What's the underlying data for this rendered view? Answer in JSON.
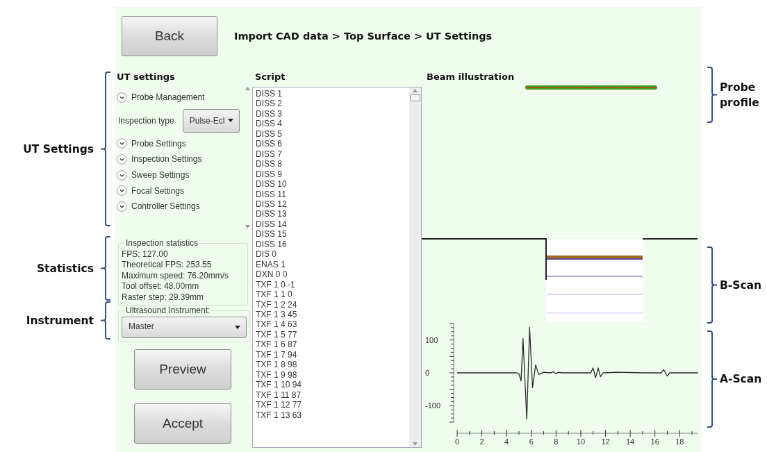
{
  "annotations_left": [
    {
      "label": "UT Settings"
    },
    {
      "label": "Statistics"
    },
    {
      "label": "Instrument"
    }
  ],
  "annotations_right": [
    {
      "label": "Probe profile"
    },
    {
      "label": "B-Scan"
    },
    {
      "label": "A-Scan"
    }
  ],
  "back_button": "Back",
  "breadcrumb": "Import CAD data > Top Surface > UT Settings",
  "ut_settings": {
    "title": "UT settings",
    "items": [
      {
        "kind": "expander",
        "label": "Probe Management"
      },
      {
        "kind": "combo",
        "label": "Inspection type",
        "value": "Pulse-Ecl"
      },
      {
        "kind": "expander",
        "label": "Probe Settings"
      },
      {
        "kind": "expander",
        "label": "Inspection Settings"
      },
      {
        "kind": "expander",
        "label": "Sweep Settings"
      },
      {
        "kind": "expander",
        "label": "Focal Settings"
      },
      {
        "kind": "expander",
        "label": "Controller Settings"
      }
    ]
  },
  "statistics": {
    "title": "Inspection statistics",
    "lines": [
      "FPS: 127.00",
      "Theoretical FPS: 253.55",
      "Maximum speed: 76.20mm/s",
      "Tool offset: 48.00mm",
      "Raster step: 29.39mm"
    ]
  },
  "instrument": {
    "title": "Ultrasound Instrument:",
    "value": "Master"
  },
  "buttons": [
    "Preview",
    "Accept"
  ],
  "script": {
    "title": "Script",
    "lines": [
      "DISS 1",
      "DISS 2",
      "DISS 3",
      "DISS 4",
      "DISS 5",
      "DISS 6",
      "DISS 7",
      "DISS 8",
      "DISS 9",
      "DISS 10",
      "DISS 11",
      "DISS 12",
      "DISS 13",
      "DISS 14",
      "DISS 15",
      "DISS 16",
      "DIS 0",
      "ENAS 1",
      "DXN 0 0",
      "TXF 1 0 -1",
      "TXF 1 1 0",
      "TXF 1 2 24",
      "TXF 1 3 45",
      "TXF 1 4 63",
      "TXF 1 5 77",
      "TXF 1 6 87",
      "TXF 1 7 94",
      "TXF 1 8 98",
      "TXF 1 9 98",
      "TXF 1 10 94",
      "TXF 1 11 87",
      "TXF 1 12 77",
      "TXF 1 13 63"
    ]
  },
  "beam": {
    "title": "Beam illustration"
  },
  "a_scan": {
    "chart_data": {
      "type": "line",
      "x": [
        0,
        4.8,
        5.0,
        5.17,
        5.33,
        5.63,
        5.86,
        6.1,
        6.35,
        6.6,
        7.0,
        7.5,
        7.8,
        8.0,
        8.2,
        8.5,
        9.5,
        10.8,
        11.0,
        11.2,
        11.4,
        11.6,
        11.8,
        13,
        15,
        16.5,
        16.7,
        17.0,
        17.2,
        18,
        19.5
      ],
      "series": [
        {
          "color": "#2a2a2a",
          "values": [
            0,
            0,
            -3,
            -25,
            105,
            -140,
            138,
            -45,
            24,
            -5,
            2,
            0,
            3,
            -3,
            2,
            0,
            0,
            0,
            15,
            -15,
            15,
            -12,
            0,
            2,
            0,
            0,
            10,
            -10,
            0,
            0,
            0
          ]
        }
      ],
      "xlim": [
        0,
        19.5
      ],
      "ylim": [
        -150,
        150
      ],
      "xticks": [
        0,
        2,
        4,
        6,
        8,
        10,
        12,
        14,
        16,
        18
      ],
      "yticks": [
        -100,
        0,
        100
      ]
    }
  }
}
